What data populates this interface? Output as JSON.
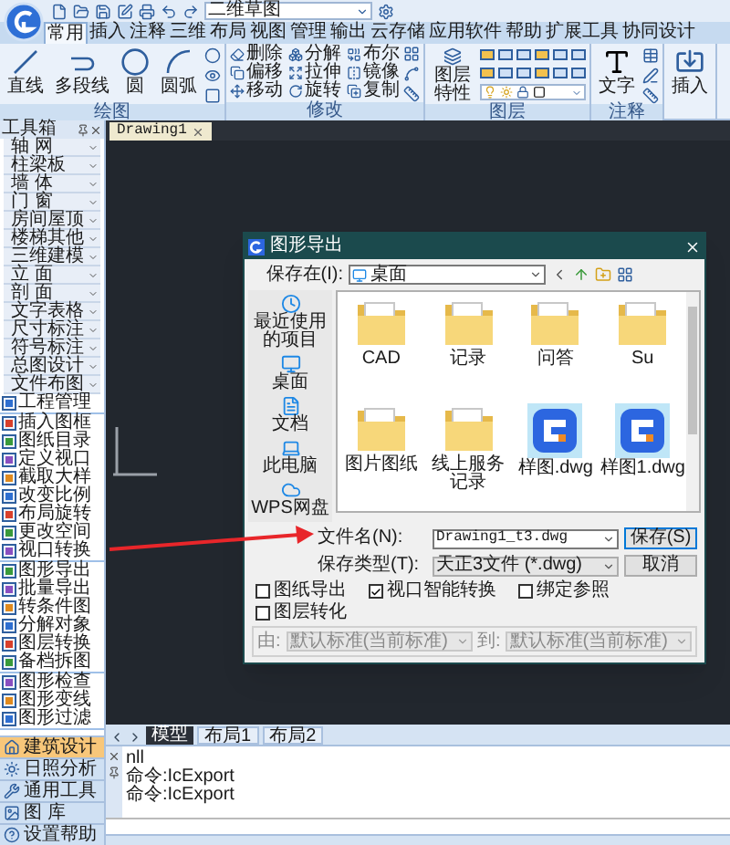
{
  "workspace": "二维草图",
  "tabs": [
    {
      "label": "常用",
      "selected": true
    },
    {
      "label": "插入",
      "selected": false
    },
    {
      "label": "注释",
      "selected": false
    },
    {
      "label": "三维",
      "selected": false
    },
    {
      "label": "布局",
      "selected": false
    },
    {
      "label": "视图",
      "selected": false
    },
    {
      "label": "管理",
      "selected": false
    },
    {
      "label": "输出",
      "selected": false
    },
    {
      "label": "云存储",
      "selected": false
    },
    {
      "label": "应用软件",
      "selected": false
    },
    {
      "label": "帮助",
      "selected": false
    },
    {
      "label": "扩展工具",
      "selected": false
    },
    {
      "label": "协同设计",
      "selected": false
    }
  ],
  "ribbon": [
    {
      "kind": "draw",
      "label": "绘图",
      "items": [
        "直线",
        "多段线",
        "圆",
        "圆弧"
      ]
    },
    {
      "kind": "modify",
      "label": "修改",
      "items": [
        "删除",
        "分解",
        "布尔",
        "偏移",
        "拉伸",
        "镜像",
        "移动",
        "旋转",
        "复制"
      ]
    },
    {
      "kind": "layer",
      "label": "图层",
      "items": [
        "图层特性"
      ]
    },
    {
      "kind": "annotate",
      "label": "注释",
      "items": [
        "文字"
      ]
    },
    {
      "kind": "insert",
      "items": [
        "插入"
      ]
    }
  ],
  "toolbox": {
    "title": "工具箱",
    "menus": [
      "轴 网",
      "柱梁板",
      "墙 体",
      "门 窗",
      "房间屋顶",
      "楼梯其他",
      "三维建模",
      "立 面",
      "剖 面",
      "文字表格",
      "尺寸标注",
      "符号标注",
      "总图设计",
      "文件布图"
    ],
    "tool_groups": [
      [
        "工程管理"
      ],
      [
        "插入图框",
        "图纸目录",
        "定义视口",
        "截取大样",
        "改变比例",
        "布局旋转",
        "更改空间",
        "视口转换"
      ],
      [
        "图形导出",
        "批量导出",
        "转条件图",
        "分解对象",
        "图层转换",
        "备档拆图"
      ],
      [
        "图形检查",
        "图形变线",
        "图形过滤"
      ]
    ],
    "categories": [
      {
        "label": "建筑设计",
        "selected": true
      },
      {
        "label": "日照分析",
        "selected": false
      },
      {
        "label": "通用工具",
        "selected": false
      },
      {
        "label": "图 库",
        "selected": false
      },
      {
        "label": "设置帮助",
        "selected": false
      }
    ]
  },
  "document_tab": "Drawing1",
  "layout_tabs": [
    {
      "label": "模型",
      "selected": true
    },
    {
      "label": "布局1",
      "selected": false
    },
    {
      "label": "布局2",
      "selected": false
    }
  ],
  "command_lines": [
    "nll",
    "命令:IcExport",
    "命令:IcExport"
  ],
  "dialog": {
    "title": "图形导出",
    "save_in_label": "保存在(I):",
    "save_in": "桌面",
    "places": [
      {
        "kind": "recent",
        "label": "最近使用的项目"
      },
      {
        "kind": "desktop",
        "label": "桌面"
      },
      {
        "kind": "documents",
        "label": "文档"
      },
      {
        "kind": "computer",
        "label": "此电脑"
      },
      {
        "kind": "cloud",
        "label": "WPS网盘"
      }
    ],
    "files": [
      {
        "kind": "folder",
        "name": "CAD"
      },
      {
        "kind": "folder",
        "name": "记录"
      },
      {
        "kind": "folder",
        "name": "问答"
      },
      {
        "kind": "folder",
        "name": "Su"
      },
      {
        "kind": "folder",
        "name": "图片图纸"
      },
      {
        "kind": "folder",
        "name": "线上服务记录"
      },
      {
        "kind": "dwg",
        "name": "样图.dwg"
      },
      {
        "kind": "dwg",
        "name": "样图1.dwg"
      }
    ],
    "file_name_label": "文件名(N):",
    "file_name": "Drawing1_t3.dwg",
    "file_type_label": "保存类型(T):",
    "file_type": "天正3文件 (*.dwg)",
    "buttons": [
      "保存(S)",
      "取消"
    ],
    "options": [
      {
        "label": "图纸导出",
        "checked": false
      },
      {
        "label": "视口智能转换",
        "checked": true
      },
      {
        "label": "绑定参照",
        "checked": false
      },
      {
        "label": "图层转化",
        "checked": false
      }
    ],
    "mapping": {
      "disabled": true,
      "from_label": "由:",
      "from": "默认标准(当前标准)",
      "to_label": "到:",
      "to": "默认标准(当前标准)"
    }
  }
}
